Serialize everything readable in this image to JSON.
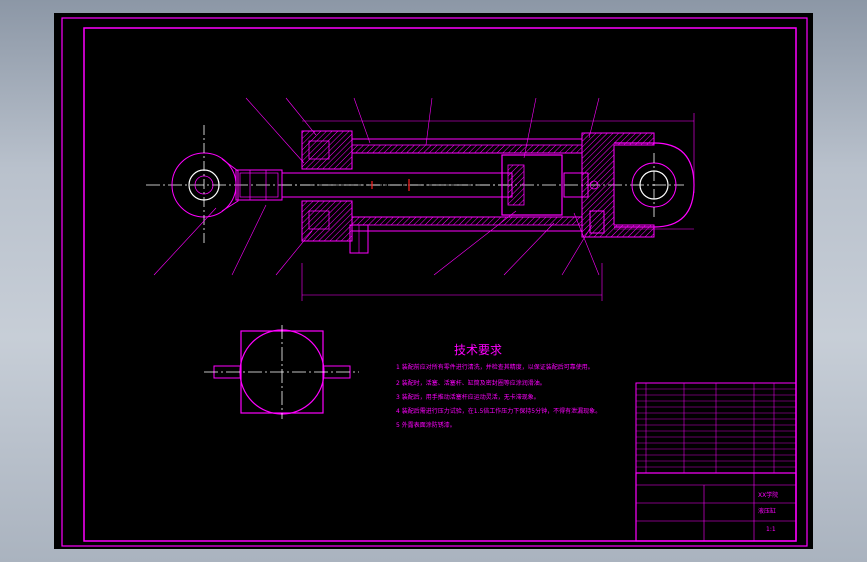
{
  "tech_requirements": {
    "title": "技术要求",
    "items": [
      "1 装配前应对所有零件进行清洗，并检查其精度，以保证装配后可靠使用。",
      "2 装配时，活塞、活塞杆、缸筒及密封圈等应涂润滑油。",
      "3 装配后，用手推动活塞杆应运动灵活，无卡滞现象。",
      "4 装配后需进行压力试验，在1.5倍工作压力下保持5分钟，不得有泄漏现象。",
      "5 外露表面涂防锈漆。"
    ]
  },
  "title_block": {
    "drawing_name": "液压缸",
    "school": "XX学院",
    "scale": "1:1"
  },
  "colors": {
    "line": "#ff00ff",
    "centerline": "#ffffff",
    "accent": "#ff2020",
    "bg": "#000000"
  }
}
